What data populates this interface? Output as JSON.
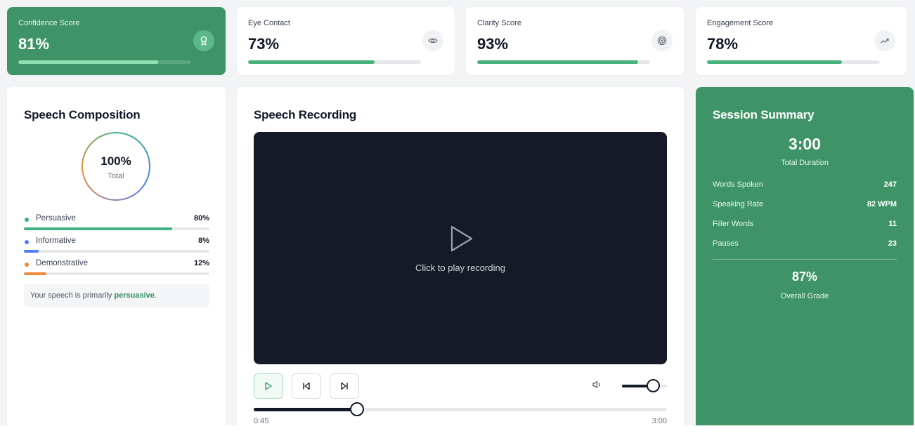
{
  "metrics": [
    {
      "label": "Confidence Score",
      "value": "81%",
      "progress": 0.81,
      "icon": "award-icon",
      "highlight": true
    },
    {
      "label": "Eye Contact",
      "value": "73%",
      "progress": 0.73,
      "icon": "eye-icon",
      "highlight": false
    },
    {
      "label": "Clarity Score",
      "value": "93%",
      "progress": 0.93,
      "icon": "target-icon",
      "highlight": false
    },
    {
      "label": "Engagement Score",
      "value": "78%",
      "progress": 0.78,
      "icon": "trending-up-icon",
      "highlight": false
    }
  ],
  "composition": {
    "title": "Speech Composition",
    "total_value": "100%",
    "total_label": "Total",
    "items": [
      {
        "name": "Persuasive",
        "pct": "80%",
        "fraction": 0.8,
        "color": "#3fb27f"
      },
      {
        "name": "Informative",
        "pct": "8%",
        "fraction": 0.08,
        "color": "#4f7df2"
      },
      {
        "name": "Demonstrative",
        "pct": "12%",
        "fraction": 0.12,
        "color": "#f08a3c"
      }
    ],
    "note_prefix": "Your speech is primarily ",
    "note_emphasis": "persuasive",
    "note_suffix": "."
  },
  "recording": {
    "title": "Speech Recording",
    "prompt": "Click to play recording",
    "current_time": "0:45",
    "total_time": "3:00",
    "position_fraction": 0.25,
    "volume_fraction": 0.7
  },
  "summary": {
    "title": "Session Summary",
    "duration": "3:00",
    "duration_label": "Total Duration",
    "stats": [
      {
        "label": "Words Spoken",
        "value": "247"
      },
      {
        "label": "Speaking Rate",
        "value": "82 WPM"
      },
      {
        "label": "Filler Words",
        "value": "11"
      },
      {
        "label": "Pauses",
        "value": "23"
      }
    ],
    "grade": "87%",
    "grade_label": "Overall Grade"
  },
  "colors": {
    "brand_green": "#3f9467",
    "progress_green": "#47b27c",
    "video_bg": "#161a26"
  }
}
